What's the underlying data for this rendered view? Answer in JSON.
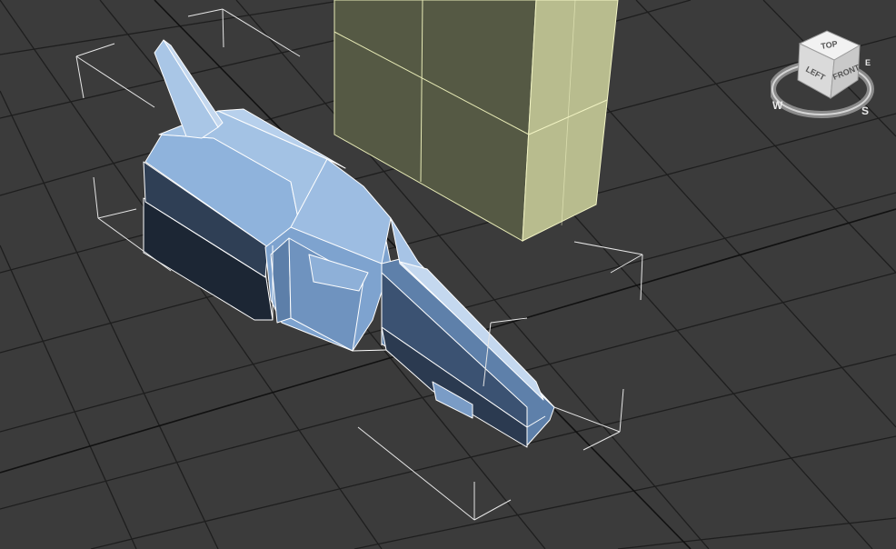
{
  "viewport": {
    "background": "#3b3b3b",
    "grid_color": "#1e1e1e",
    "selection_bracket_color": "#e8e8e8"
  },
  "objects": [
    {
      "name": "spaceship",
      "color": "#7fa7d4",
      "edge_color": "#ffffff"
    },
    {
      "name": "box",
      "color": "#b9bd8e",
      "edge_color": "#f5f7c7"
    }
  ],
  "viewcube": {
    "faces": {
      "top": "TOP",
      "left": "LEFT",
      "front": "FRONT"
    },
    "compass": {
      "west": "W",
      "south": "S",
      "east": "E"
    }
  }
}
